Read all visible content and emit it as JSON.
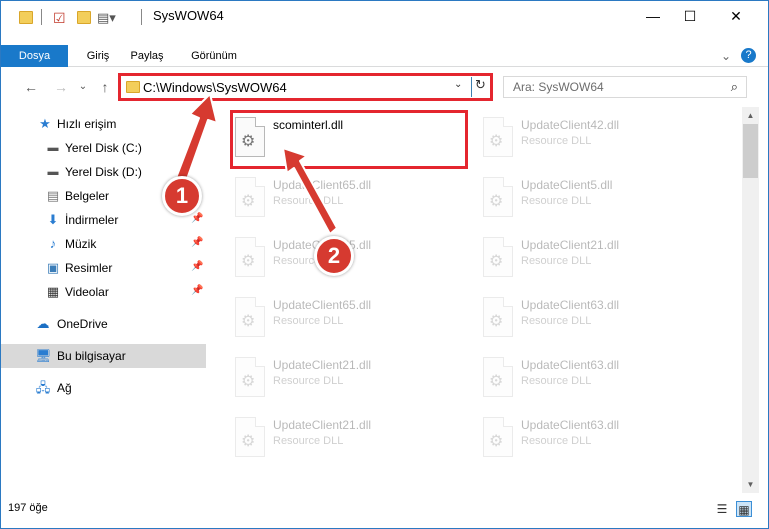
{
  "window": {
    "title": "SysWOW64",
    "controls": {
      "minimize": "—",
      "maximize": "☐",
      "close": "✕"
    }
  },
  "ribbon": {
    "tabs": [
      "Dosya",
      "Giriş",
      "Paylaş",
      "Görünüm"
    ],
    "expand_icon": "chevron-down-icon",
    "help_icon": "help-icon"
  },
  "navigation": {
    "back": "←",
    "forward": "→",
    "recent": "⌄",
    "up": "↑",
    "address": "C:\\Windows\\SysWOW64",
    "refresh": "↻",
    "dropdown": "⌄",
    "search_placeholder": "Ara: SysWOW64"
  },
  "sidebar": {
    "items": [
      {
        "label": "Hızlı erişim",
        "icon": "star-icon",
        "pinned": false
      },
      {
        "label": "Yerel Disk (C:)",
        "icon": "drive-icon",
        "pinned": true
      },
      {
        "label": "Yerel Disk (D:)",
        "icon": "drive-icon",
        "pinned": true
      },
      {
        "label": "Belgeler",
        "icon": "documents-icon",
        "pinned": true
      },
      {
        "label": "İndirmeler",
        "icon": "download-icon",
        "pinned": true
      },
      {
        "label": "Müzik",
        "icon": "music-icon",
        "pinned": true
      },
      {
        "label": "Resimler",
        "icon": "pictures-icon",
        "pinned": true
      },
      {
        "label": "Videolar",
        "icon": "videos-icon",
        "pinned": true
      },
      {
        "label": "OneDrive",
        "icon": "cloud-icon",
        "pinned": false
      },
      {
        "label": "Bu bilgisayar",
        "icon": "computer-icon",
        "pinned": false,
        "selected": true
      },
      {
        "label": "Ağ",
        "icon": "network-icon",
        "pinned": false
      }
    ]
  },
  "files": {
    "left_column": [
      {
        "name": "scominterl.dll",
        "type": "",
        "highlighted": true
      },
      {
        "name": "UpdateClient65.dll",
        "type": "Resource DLL"
      },
      {
        "name": "UpdateClient65.dll",
        "type": "Resource DLL"
      },
      {
        "name": "UpdateClient65.dll",
        "type": "Resource DLL"
      },
      {
        "name": "UpdateClient21.dll",
        "type": "Resource DLL"
      },
      {
        "name": "UpdateClient21.dll",
        "type": "Resource DLL"
      }
    ],
    "right_column": [
      {
        "name": "UpdateClient42.dll",
        "type": "Resource DLL"
      },
      {
        "name": "UpdateClient5.dll",
        "type": "Resource DLL"
      },
      {
        "name": "UpdateClient21.dll",
        "type": "Resource DLL"
      },
      {
        "name": "UpdateClient63.dll",
        "type": "Resource DLL"
      },
      {
        "name": "UpdateClient63.dll",
        "type": "Resource DLL"
      },
      {
        "name": "UpdateClient63.dll",
        "type": "Resource DLL"
      }
    ]
  },
  "status": {
    "item_count": "197 öğe"
  },
  "annotations": {
    "badge1": "1",
    "badge2": "2",
    "color": "#d63a30"
  }
}
